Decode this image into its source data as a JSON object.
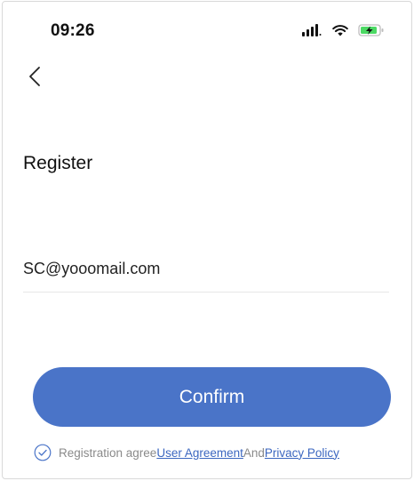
{
  "status_bar": {
    "time": "09:26",
    "icons": [
      "cellular-signal-icon",
      "wifi-icon",
      "battery-charging-icon"
    ]
  },
  "nav": {
    "back_icon": "chevron-left-icon"
  },
  "page": {
    "title": "Register"
  },
  "form": {
    "email_value": "SC@yooomail.com",
    "confirm_label": "Confirm"
  },
  "agreement": {
    "check_icon": "check-circle-icon",
    "prefix": "Registration agree",
    "user_agreement": "User Agreement",
    "and": "And",
    "privacy_policy": "Privacy Policy"
  },
  "colors": {
    "accent": "#4a74c8",
    "link": "#3c67c0",
    "battery": "#4cd964"
  }
}
